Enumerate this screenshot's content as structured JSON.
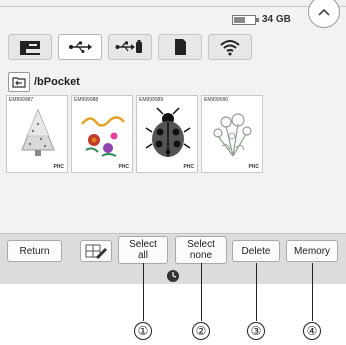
{
  "header": {
    "storage_text": "34 GB"
  },
  "tabs": [
    {
      "icon": "machine-icon"
    },
    {
      "icon": "usb-icon"
    },
    {
      "icon": "usb-device-icon"
    },
    {
      "icon": "sd-card-icon"
    },
    {
      "icon": "wifi-icon"
    }
  ],
  "path": {
    "text": "/bPocket"
  },
  "thumbnails": [
    {
      "id": "EM999987",
      "type": "PHC",
      "icon": "christmas-tree-embroidery-icon"
    },
    {
      "id": "EM999988",
      "type": "PHC",
      "icon": "floral-lettering-embroidery-icon"
    },
    {
      "id": "EM999989",
      "type": "PHC",
      "icon": "ladybug-embroidery-icon"
    },
    {
      "id": "EM999990",
      "type": "PHC",
      "icon": "flower-bouquet-embroidery-icon"
    }
  ],
  "buttons": {
    "return_label": "Return",
    "select_all_line1": "Select",
    "select_all_line2": "all",
    "select_none_line1": "Select",
    "select_none_line2": "none",
    "delete_label": "Delete",
    "memory_label": "Memory"
  },
  "callouts": [
    "①",
    "②",
    "③",
    "④"
  ]
}
